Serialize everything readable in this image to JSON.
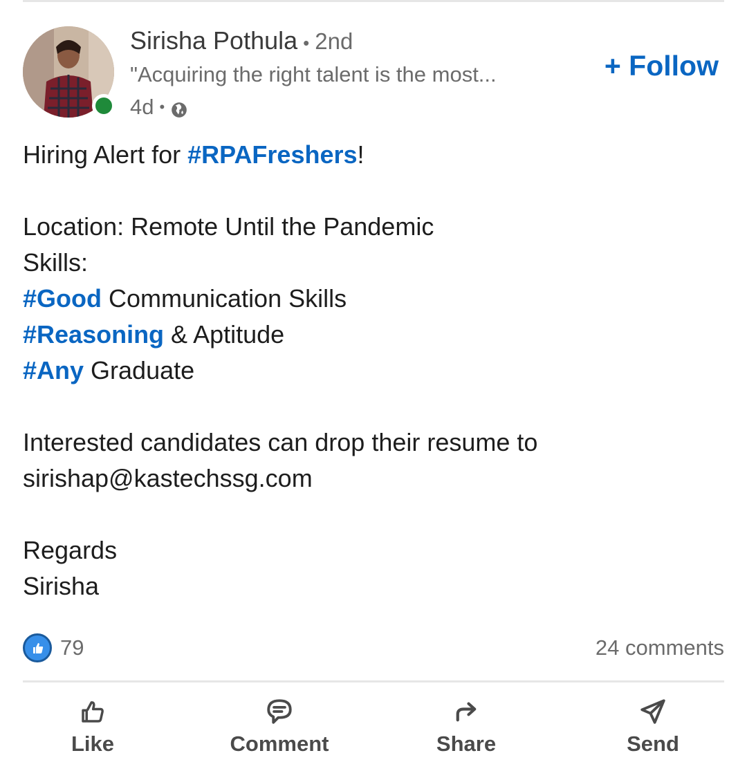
{
  "post": {
    "author": {
      "name": "Sirisha Pothula",
      "degree": "2nd",
      "headline": "\"Acquiring the right talent is the most...",
      "time": "4d",
      "visibility_icon": "globe-icon",
      "online": true
    },
    "follow_label": "+ Follow",
    "body": [
      [
        {
          "text": "Hiring Alert for "
        },
        {
          "text": "#RPAFreshers",
          "hashtag": true
        },
        {
          "text": "!"
        }
      ],
      [],
      [
        {
          "text": "Location: Remote Until the Pandemic"
        }
      ],
      [
        {
          "text": "Skills:"
        }
      ],
      [
        {
          "text": "#Good",
          "hashtag": true
        },
        {
          "text": " Communication Skills"
        }
      ],
      [
        {
          "text": "#Reasoning",
          "hashtag": true
        },
        {
          "text": " & Aptitude"
        }
      ],
      [
        {
          "text": "#Any",
          "hashtag": true
        },
        {
          "text": " Graduate"
        }
      ],
      [],
      [
        {
          "text": "Interested candidates can drop their resume to"
        }
      ],
      [
        {
          "text": "sirishap@kastechssg.com"
        }
      ],
      [],
      [
        {
          "text": "Regards"
        }
      ],
      [
        {
          "text": "Sirisha"
        }
      ]
    ],
    "reactions": {
      "count": "79",
      "icon": "like-reaction-icon"
    },
    "comments": "24 comments"
  },
  "actions": [
    {
      "label": "Like",
      "icon": "thumbs-up-icon"
    },
    {
      "label": "Comment",
      "icon": "comment-icon"
    },
    {
      "label": "Share",
      "icon": "share-arrow-icon"
    },
    {
      "label": "Send",
      "icon": "send-icon"
    }
  ],
  "colors": {
    "accent": "#0a66c2",
    "online": "#1f8a3a",
    "muted_text": "#6b6b6b",
    "reaction_blue": "#378fe9"
  }
}
